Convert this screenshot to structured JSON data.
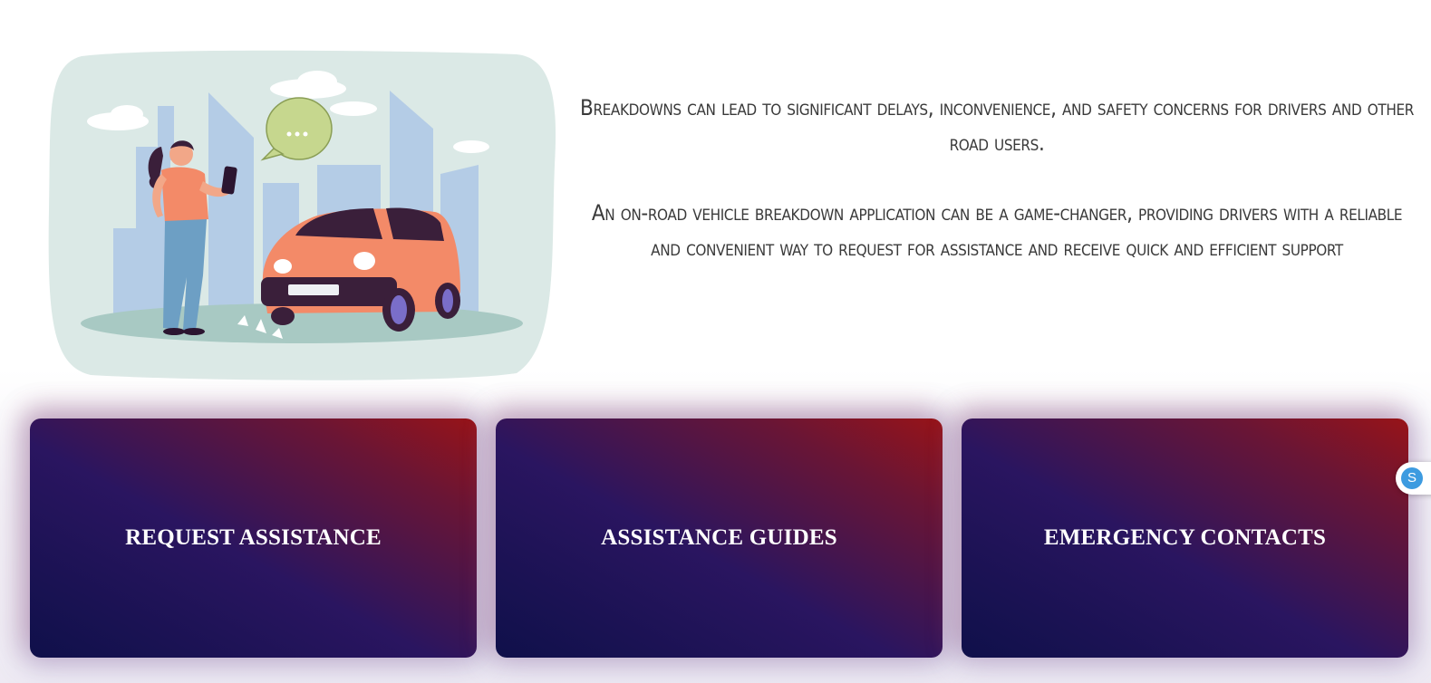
{
  "intro": {
    "paragraph_1": "Breakdowns can lead to significant delays, inconvenience, and safety concerns for drivers and other road users.",
    "paragraph_2": "An on-road vehicle breakdown application can be a game-changer, providing drivers with a reliable and convenient way to request for assistance and receive quick and efficient support"
  },
  "illustration": {
    "name": "woman-phone-broken-car-illustration",
    "speech_bubble_text": "..."
  },
  "cards": [
    {
      "label": "REQUEST ASSISTANCE"
    },
    {
      "label": "ASSISTANCE GUIDES"
    },
    {
      "label": "EMERGENCY CONTACTS"
    }
  ],
  "chat_widget": {
    "icon": "chat-icon",
    "letter": "S"
  },
  "colors": {
    "card_gradient_start": "#0f104a",
    "card_gradient_mid": "#2a1560",
    "card_gradient_end": "#981418",
    "text": "#3a3a3a"
  }
}
